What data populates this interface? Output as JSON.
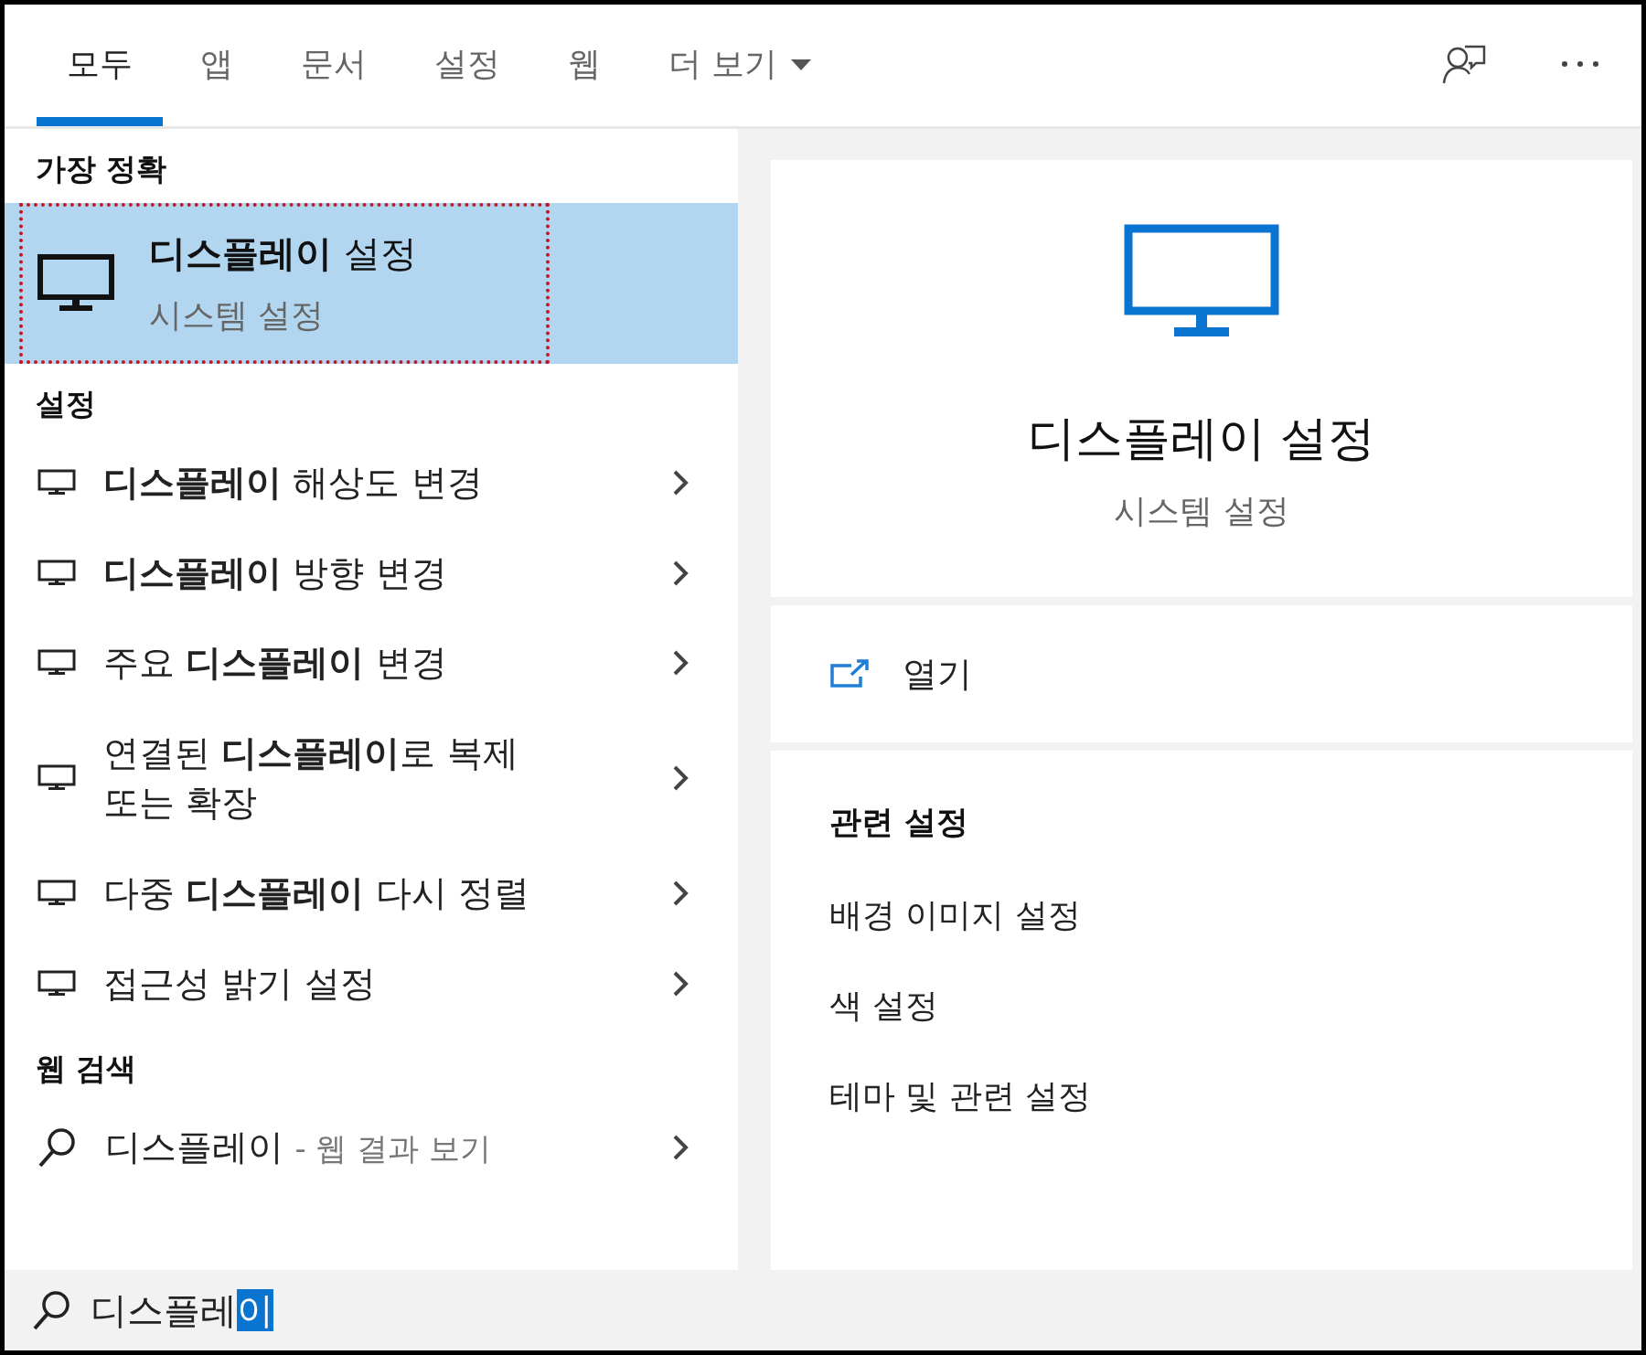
{
  "tabs": [
    {
      "label": "모두",
      "selected": true
    },
    {
      "label": "앱",
      "selected": false
    },
    {
      "label": "문서",
      "selected": false
    },
    {
      "label": "설정",
      "selected": false
    },
    {
      "label": "웹",
      "selected": false
    },
    {
      "label": "더 보기",
      "selected": false,
      "dropdown": true
    }
  ],
  "best_match": {
    "heading": "가장 정확",
    "title": "**디스플레이** 설정",
    "subtitle": "시스템 설정",
    "selected": true,
    "annotated": true
  },
  "settings": {
    "heading": "설정",
    "items": [
      {
        "label": "**디스플레이** 해상도 변경"
      },
      {
        "label": "**디스플레이** 방향 변경"
      },
      {
        "label": "주요 **디스플레이** 변경"
      },
      {
        "label": "연결된 **디스플레이**로 복제 또는 확장"
      },
      {
        "label": "다중 **디스플레이** 다시 정렬"
      },
      {
        "label": "접근성 밝기 설정"
      }
    ]
  },
  "web_search": {
    "heading": "웹 검색",
    "items": [
      {
        "query": "디스플레이",
        "hint": "- 웹 결과 보기"
      }
    ]
  },
  "preview": {
    "title": "디스플레이 설정",
    "subtitle": "시스템 설정",
    "action": "열기",
    "related_heading": "관련 설정",
    "related": [
      "배경 이미지 설정",
      "색 설정",
      "테마 및 관련 설정"
    ]
  },
  "search": {
    "value": "디스플레",
    "selected_text": "이"
  }
}
